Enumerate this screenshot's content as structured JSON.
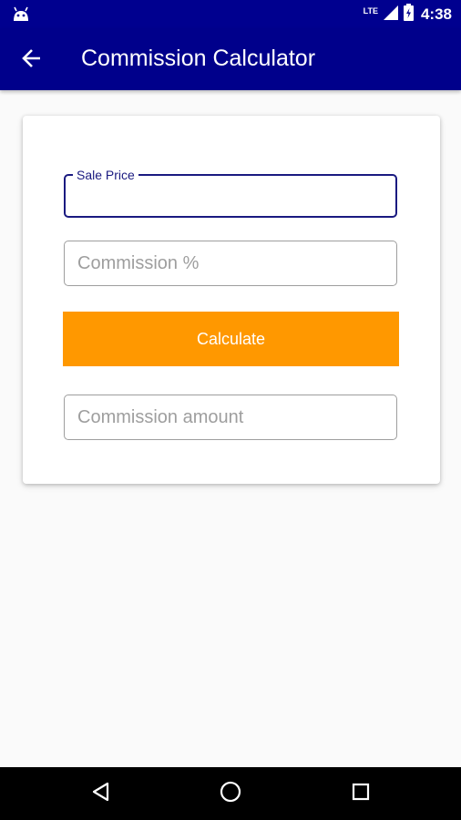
{
  "status_bar": {
    "icons": [
      "android-icon",
      "lte-signal-icon",
      "battery-icon"
    ],
    "network": "LTE",
    "time": "4:38"
  },
  "app_bar": {
    "back_icon": "arrow-left-icon",
    "title": "Commission Calculator",
    "color": "#00008b"
  },
  "form": {
    "sale_price": {
      "label": "Sale Price",
      "value": ""
    },
    "commission_percent": {
      "placeholder": "Commission %",
      "value": ""
    },
    "calculate_label": "Calculate",
    "calculate_color": "#ff9800",
    "commission_amount": {
      "placeholder": "Commission amount",
      "value": ""
    }
  },
  "nav_bar": {
    "icons": [
      "back-triangle-icon",
      "home-circle-icon",
      "recents-square-icon"
    ]
  }
}
